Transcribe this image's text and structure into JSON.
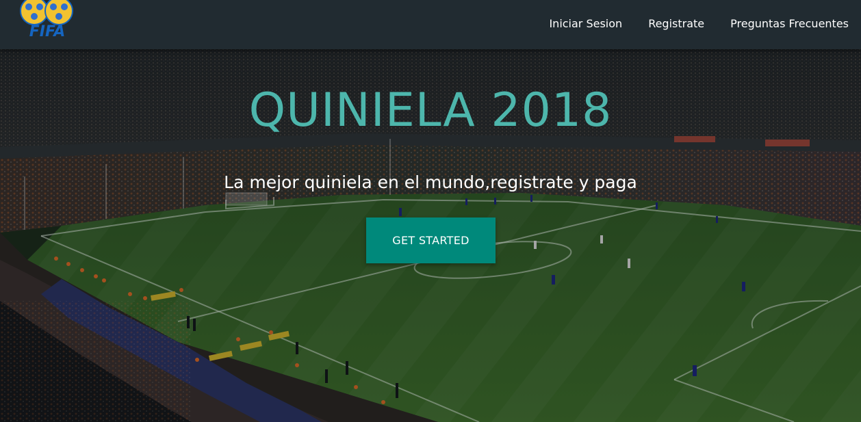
{
  "navbar": {
    "brand_text": "FIFA",
    "links": [
      {
        "label": "Iniciar Sesion"
      },
      {
        "label": "Registrate"
      },
      {
        "label": "Preguntas Frecuentes"
      }
    ]
  },
  "hero": {
    "title": "QUINIELA 2018",
    "subtitle": "La mejor quiniela en el mundo,registrate y paga",
    "cta_label": "GET STARTED"
  },
  "colors": {
    "navbar_bg": "#212b31",
    "title": "#4db6ac",
    "cta_bg": "#00897b",
    "brand_blue": "#1565c0",
    "brand_gold": "#f2c230"
  },
  "icons": {
    "brand": "fifa-logo-icon",
    "background": "stadium-background-image"
  }
}
